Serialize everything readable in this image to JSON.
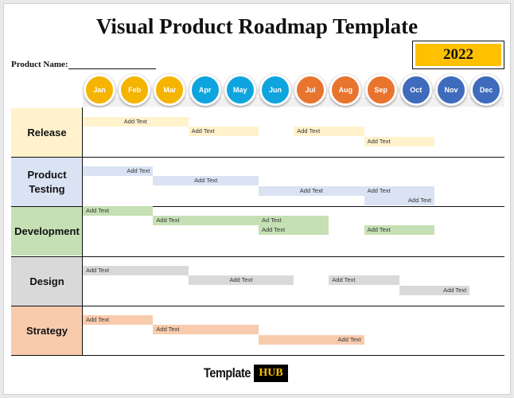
{
  "title": "Visual Product Roadmap Template",
  "product_name_label": "Product Name:",
  "year": "2022",
  "colors": {
    "q1": "#f4b400",
    "q2": "#0ea5de",
    "q3": "#e8742e",
    "q4": "#3f6bbd",
    "year_bg": "#ffc000"
  },
  "months": [
    {
      "label": "Jan",
      "color": "#f4b400"
    },
    {
      "label": "Feb",
      "color": "#f4b400"
    },
    {
      "label": "Mar",
      "color": "#f4b400"
    },
    {
      "label": "Apr",
      "color": "#0ea5de"
    },
    {
      "label": "May",
      "color": "#0ea5de"
    },
    {
      "label": "Jun",
      "color": "#0ea5de"
    },
    {
      "label": "Jul",
      "color": "#e8742e"
    },
    {
      "label": "Aug",
      "color": "#e8742e"
    },
    {
      "label": "Sep",
      "color": "#e8742e"
    },
    {
      "label": "Oct",
      "color": "#3f6bbd"
    },
    {
      "label": "Nov",
      "color": "#3f6bbd"
    },
    {
      "label": "Dec",
      "color": "#3f6bbd"
    }
  ],
  "rows": [
    {
      "label": "Release",
      "color": "#fff2cc",
      "bars": [
        {
          "text": "Add Text",
          "start": 1,
          "end": 3,
          "lane": 0,
          "align": "center"
        },
        {
          "text": "Add Text",
          "start": 4,
          "end": 5,
          "lane": 1,
          "align": "left"
        },
        {
          "text": "Add Text",
          "start": 7,
          "end": 8,
          "lane": 1,
          "align": "left"
        },
        {
          "text": "Add Text",
          "start": 9,
          "end": 10,
          "lane": 2,
          "align": "left"
        }
      ]
    },
    {
      "label": "Product Testing",
      "color": "#dae3f3",
      "bars": [
        {
          "text": "Add Text",
          "start": 1,
          "end": 2,
          "lane": 0,
          "align": "right"
        },
        {
          "text": "Add Text",
          "start": 3,
          "end": 5,
          "lane": 1,
          "align": "center"
        },
        {
          "text": "Add Text",
          "start": 6,
          "end": 8,
          "lane": 2,
          "align": "center"
        },
        {
          "text": "Add Text",
          "start": 9,
          "end": 10,
          "lane": 2,
          "align": "left"
        },
        {
          "text": "Add Text",
          "start": 9,
          "end": 10,
          "lane": 3,
          "align": "right"
        }
      ]
    },
    {
      "label": "Development",
      "color": "#c5e0b4",
      "bars": [
        {
          "text": "Add Text",
          "start": 1,
          "end": 2,
          "lane": -1,
          "align": "left"
        },
        {
          "text": "Add Text",
          "start": 3,
          "end": 7,
          "lane": 0,
          "align": "left"
        },
        {
          "text": "Ad Text",
          "start": 6,
          "end": 7,
          "lane": 0,
          "align": "left"
        },
        {
          "text": "Add Text",
          "start": 6,
          "end": 7,
          "lane": 1,
          "align": "left"
        },
        {
          "text": "Add Text",
          "start": 9,
          "end": 10,
          "lane": 1,
          "align": "left"
        }
      ]
    },
    {
      "label": "Design",
      "color": "#d9d9d9",
      "bars": [
        {
          "text": "Add Text",
          "start": 1,
          "end": 3,
          "lane": 0,
          "align": "left"
        },
        {
          "text": "Add Text",
          "start": 4,
          "end": 6,
          "lane": 1,
          "align": "center"
        },
        {
          "text": "Add Text",
          "start": 8,
          "end": 9,
          "lane": 1,
          "align": "left"
        },
        {
          "text": "Add Text",
          "start": 10,
          "end": 11,
          "lane": 2,
          "align": "right"
        }
      ]
    },
    {
      "label": "Strategy",
      "color": "#f8cbad",
      "bars": [
        {
          "text": "Add Text",
          "start": 1,
          "end": 2,
          "lane": 0,
          "align": "left"
        },
        {
          "text": "Add Text",
          "start": 3,
          "end": 5,
          "lane": 1,
          "align": "left"
        },
        {
          "text": "Add Text",
          "start": 6,
          "end": 8,
          "lane": 2,
          "align": "right"
        }
      ]
    }
  ],
  "footer": {
    "logo_text": "Template",
    "logo_badge": "HUB"
  }
}
